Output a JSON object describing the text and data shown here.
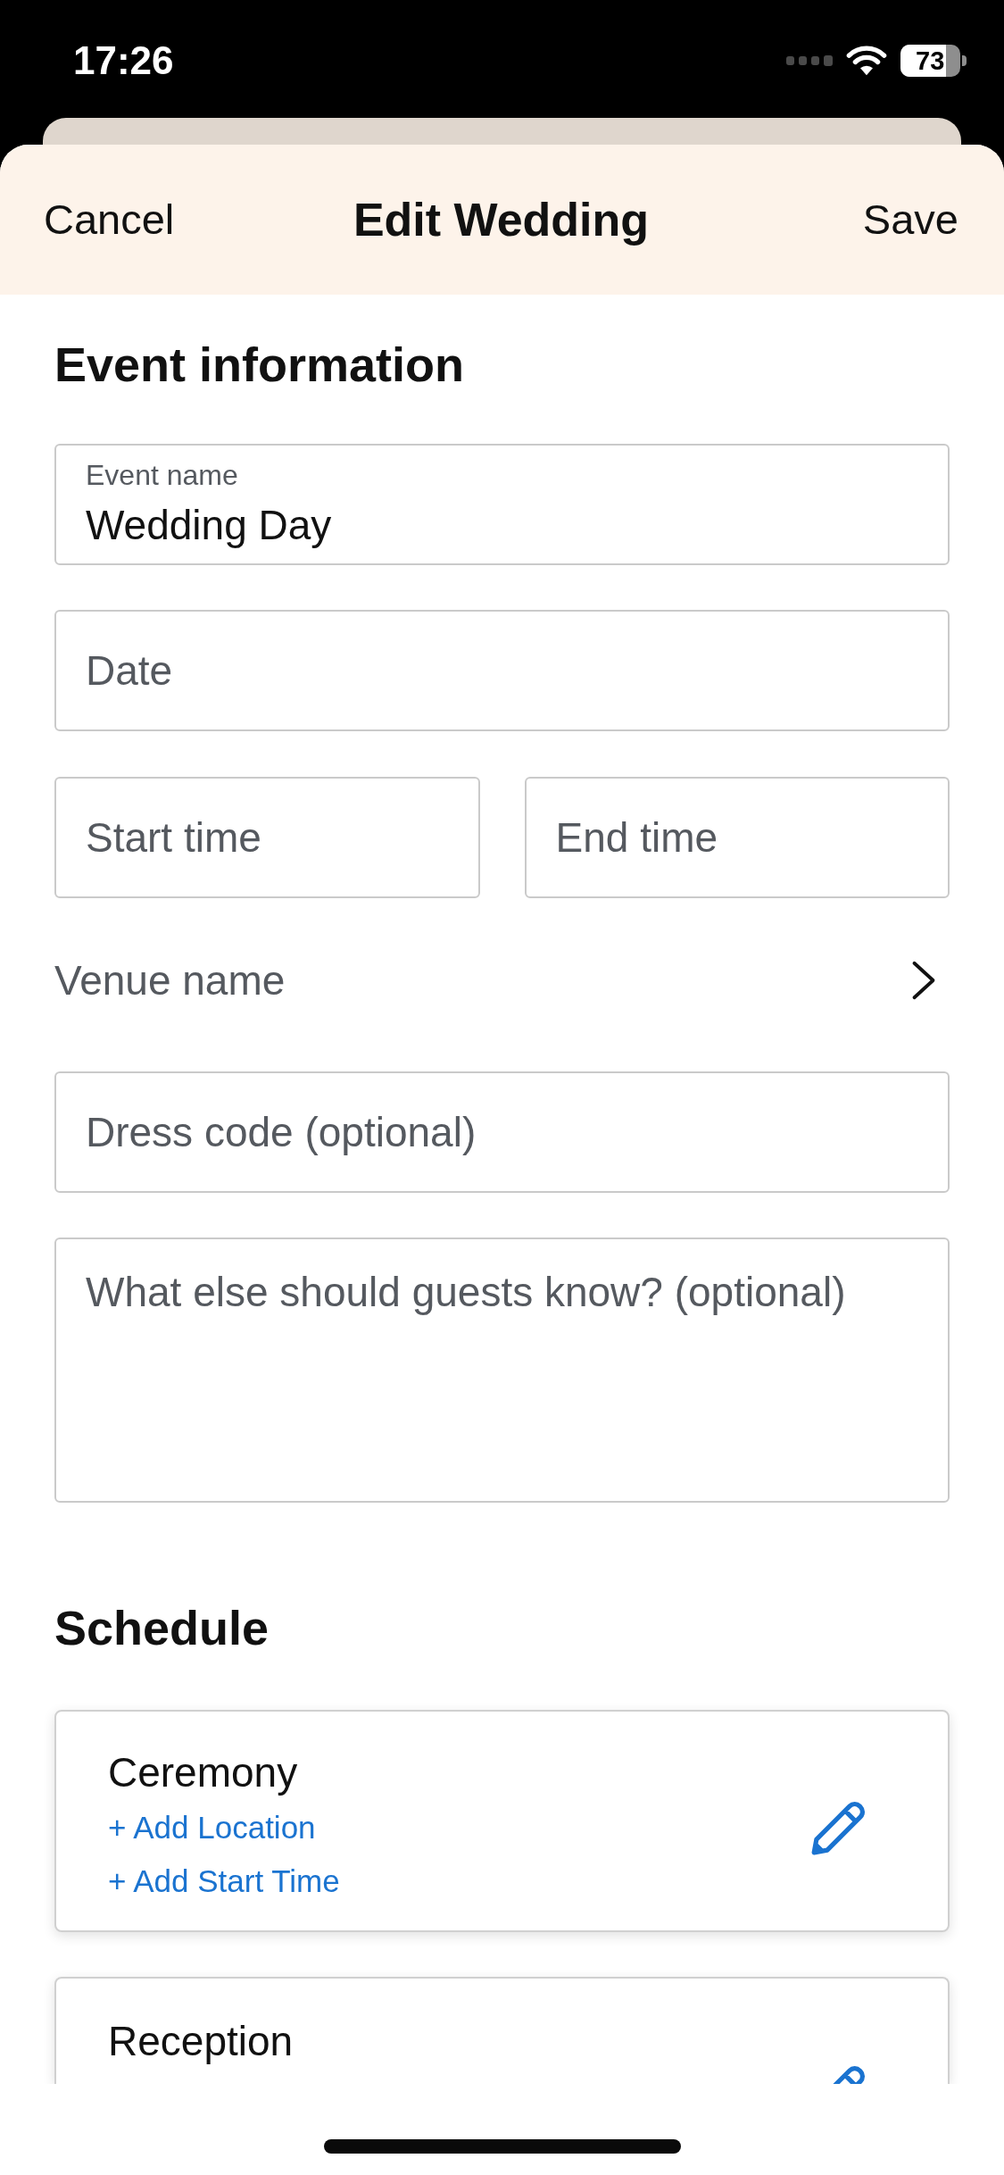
{
  "status_bar": {
    "time": "17:26",
    "battery": "73"
  },
  "header": {
    "cancel": "Cancel",
    "title": "Edit Wedding",
    "save": "Save"
  },
  "event_information": {
    "heading": "Event information",
    "fields": [
      {
        "kind": "floating",
        "label": "Event name",
        "value": "Wedding Day"
      },
      {
        "kind": "input",
        "placeholder": "Date"
      },
      {
        "kind": "pair",
        "fields": [
          {
            "placeholder": "Start time"
          },
          {
            "placeholder": "End time"
          }
        ]
      },
      {
        "kind": "picker",
        "label": "Venue name"
      },
      {
        "kind": "input",
        "placeholder": "Dress code (optional)"
      },
      {
        "kind": "textarea",
        "placeholder": "What else should guests know? (optional)"
      }
    ]
  },
  "schedule": {
    "heading": "Schedule",
    "items": [
      {
        "name": "Ceremony",
        "links": [
          "+ Add Location",
          "+ Add Start Time"
        ]
      },
      {
        "name": "Reception"
      }
    ]
  }
}
